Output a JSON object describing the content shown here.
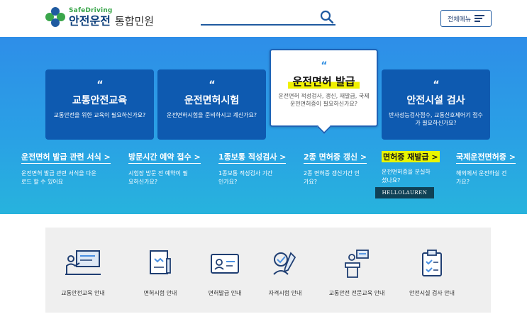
{
  "header": {
    "logo_en": "SafeDriving",
    "logo_ko_main": "안전운전",
    "logo_ko_sub": "통합민원",
    "search_placeholder": "",
    "menu_label": "전체메뉴"
  },
  "cards": [
    {
      "quote": "“",
      "title": "교통안전교육",
      "desc": "교통안전을 위한 교육이 필요하신가요?"
    },
    {
      "quote": "“",
      "title": "운전면허시험",
      "desc": "운전면허시험을 준비하시고 계신가요?"
    },
    {
      "quote": "“",
      "title": "운전면허 발급",
      "desc": "운전면허 적성검사, 갱신, 재발급, 국제운전면허증이 필요하신가요?"
    },
    {
      "quote": "“",
      "title": "안전시설 검사",
      "desc": "반사성능검사접수, 교통신호제어기 접수가 필요하신가요?"
    }
  ],
  "links": [
    {
      "title": "운전면허 발급 관련 서식",
      "desc": "운전면허 발급 관련 서식을 다운로드 할 수 있어요"
    },
    {
      "title": "방문시간 예약 접수",
      "desc": "시험장 방문 전 예약이 필요하신가요?"
    },
    {
      "title": "1종보통 적성검사",
      "desc": "1종보통 적성검사 기간인가요?"
    },
    {
      "title": "2종 면허증 갱신",
      "desc": "2종 면허증 갱신기간 인가요?"
    },
    {
      "title": "면허증 재발급",
      "desc": "운전면허증을 분실하셨나요?"
    },
    {
      "title": "국제운전면허증",
      "desc": "해외에서 운전하실 건가요?"
    }
  ],
  "link_arrow": ">",
  "badge": "HELLOLAUREN",
  "quick_menu": [
    {
      "label": "교통안전교육 안내",
      "icon": "presentation-board-icon"
    },
    {
      "label": "면허시험 안내",
      "icon": "exam-document-icon"
    },
    {
      "label": "면허발급 안내",
      "icon": "license-card-icon"
    },
    {
      "label": "자격시험 안내",
      "icon": "qualification-pen-icon"
    },
    {
      "label": "교통안전 전문교육 안내",
      "icon": "lecture-podium-icon"
    },
    {
      "label": "안전시설 검사 안내",
      "icon": "checklist-icon"
    }
  ],
  "colors": {
    "brand_navy": "#0e5ab0",
    "banner_blue": "#2e8ee8",
    "highlight_yellow": "#e9f500",
    "logo_green": "#3aa64b"
  }
}
